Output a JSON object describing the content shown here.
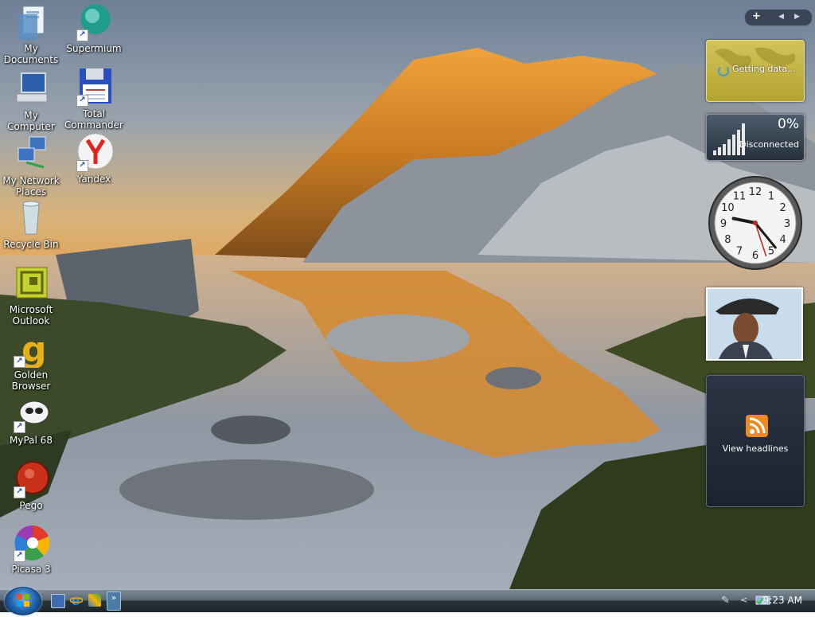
{
  "desktop": {
    "icons": [
      {
        "label": "My Documents",
        "icon": "documents-folder-icon"
      },
      {
        "label": "My Computer",
        "icon": "computer-icon"
      },
      {
        "label": "My Network Places",
        "icon": "network-icon"
      },
      {
        "label": "Recycle Bin",
        "icon": "recycle-bin-icon"
      },
      {
        "label": "Microsoft Outlook",
        "icon": "outlook-icon"
      },
      {
        "label": "Golden Browser",
        "icon": "golden-browser-icon"
      },
      {
        "label": "MyPal 68",
        "icon": "mypal-icon"
      },
      {
        "label": "Pego",
        "icon": "pego-icon"
      },
      {
        "label": "Picasa 3",
        "icon": "picasa-icon"
      },
      {
        "label": "Supermium",
        "icon": "supermium-icon"
      },
      {
        "label": "Total Commander",
        "icon": "floppy-disk-icon"
      },
      {
        "label": "Yandex",
        "icon": "yandex-icon"
      }
    ]
  },
  "sidebar": {
    "controls": {
      "add": "+",
      "prev": "◀",
      "next": "▶"
    },
    "weather": {
      "status": "Getting data..."
    },
    "network": {
      "percent": "0%",
      "status": "Disconnected"
    },
    "clock": {
      "hour": 9,
      "minute": 23,
      "second": 27
    },
    "feed": {
      "label": "View headlines"
    }
  },
  "taskbar": {
    "start_icon": "windows-logo-icon",
    "quick_launch": [
      "show-desktop-icon",
      "internet-explorer-icon",
      "switch-windows-icon",
      "more-items-icon"
    ],
    "tray_icons": [
      "pen-icon",
      "chevron-left-icon",
      "network-status-icon"
    ],
    "time": "9:23 AM"
  }
}
